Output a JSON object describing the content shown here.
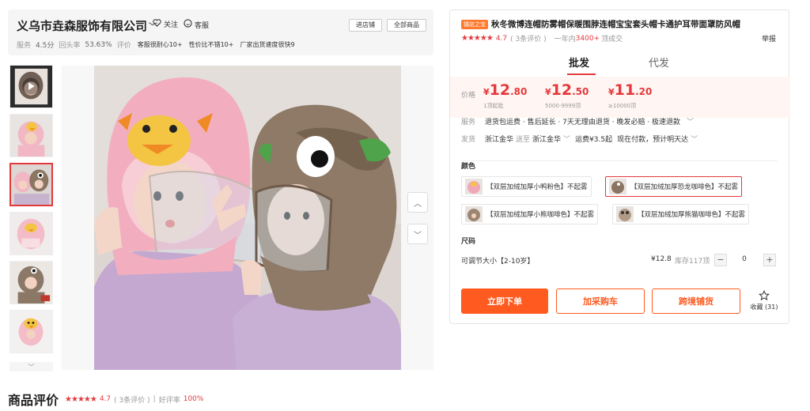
{
  "store": {
    "name": "义乌市垚森服饰有限公司",
    "follow_label": "关注",
    "service_label": "客服",
    "enter_shop_label": "进店铺",
    "all_products_label": "全部商品",
    "stats": [
      {
        "label": "服务",
        "value": "4.5分"
      },
      {
        "label": "回头率",
        "value": "53.63%"
      },
      {
        "label": "评价",
        "value": "客服很耐心10+"
      }
    ],
    "tags": [
      "性价比不错10+",
      "厂家出货速度很快9"
    ]
  },
  "gallery": {
    "thumb_count": 6,
    "selected_index": 2,
    "thumb_icons": [
      "play-icon",
      "chevron-up-icon",
      "chevron-down-icon"
    ]
  },
  "reviews": {
    "title": "商品评价",
    "stars": "★★★★★",
    "rating": "4.7",
    "count": "( 3条评价 )",
    "separator": "|",
    "good_rate_label": "好评率",
    "good_rate": "100%"
  },
  "product": {
    "badge": "镇店之宝",
    "title": "秋冬微博连帽防雾帽保暖围脖连帽宝宝套头帽卡通护耳带面罩防风帽",
    "stars": "★★★★★",
    "rating": "4.7",
    "review_count": "( 3条评价 )",
    "sales_prefix": "一年内",
    "sales_count": "3400+",
    "sales_suffix": "顶成交",
    "report_label": "举报",
    "tabs": [
      "批发",
      "代发"
    ],
    "price_label": "价格",
    "prices": [
      {
        "currency": "¥",
        "int": "12",
        "dec": ".80",
        "note": "1顶起批"
      },
      {
        "currency": "¥",
        "int": "12",
        "dec": ".50",
        "note": "5000-9999顶"
      },
      {
        "currency": "¥",
        "int": "11",
        "dec": ".20",
        "note": "≥10000顶"
      }
    ],
    "service_label": "服务",
    "service_text": "退货包运费 · 售后延长 · 7天无理由退货 · 晚发必赔 · 极速退款",
    "ship_label": "发货",
    "ship_from": "浙江金华",
    "ship_to_word": "送至",
    "ship_to": "浙江金华",
    "ship_fee": "运费¥3.5起",
    "ship_eta": "现在付款，预计明天达",
    "color_label": "颜色",
    "colors": [
      {
        "label": "【双层加绒加厚小鸭粉色】不起雾",
        "swatch": "#f1a7b8"
      },
      {
        "label": "【双层加绒加厚恐龙咖啡色】不起雾",
        "swatch": "#8a7562"
      },
      {
        "label": "【双层加绒加厚小熊咖啡色】不起雾",
        "swatch": "#9c8672"
      },
      {
        "label": "【双层加绒加厚熊猫咖啡色】不起雾",
        "swatch": "#b09a86"
      }
    ],
    "selected_color": 1,
    "size_label": "尺码",
    "size_name": "可调节大小【2-10岁】",
    "size_price": "¥12.8",
    "size_stock": "库存117顶",
    "qty_minus": "−",
    "qty_value": "0",
    "qty_plus": "+",
    "buy_label": "立即下单",
    "cart_label": "加采购车",
    "crossborder_label": "跨境铺货",
    "fav_label": "收藏 (31)"
  },
  "colors": {
    "accent": "#e4393c",
    "button": "#ff5a1f",
    "price_bg": "#fff5f2"
  }
}
